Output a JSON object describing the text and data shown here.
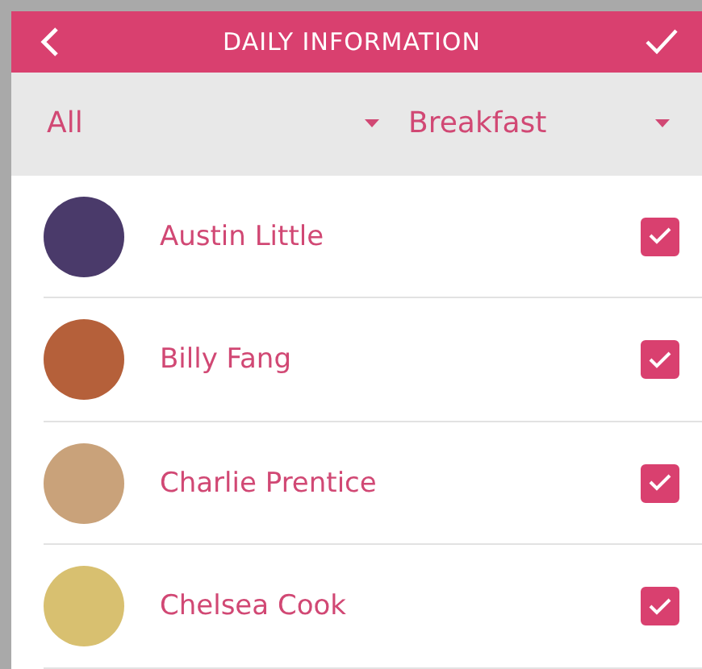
{
  "header": {
    "title": "DAILY INFORMATION"
  },
  "filters": [
    {
      "value": "All"
    },
    {
      "value": "Breakfast"
    }
  ],
  "children": [
    {
      "name": "Austin Little",
      "checked": true,
      "color": "#4a3a6a"
    },
    {
      "name": "Billy Fang",
      "checked": true,
      "color": "#b5603a"
    },
    {
      "name": "Charlie Prentice",
      "checked": true,
      "color": "#c9a27a"
    },
    {
      "name": "Chelsea Cook",
      "checked": true,
      "color": "#d8c070"
    }
  ]
}
